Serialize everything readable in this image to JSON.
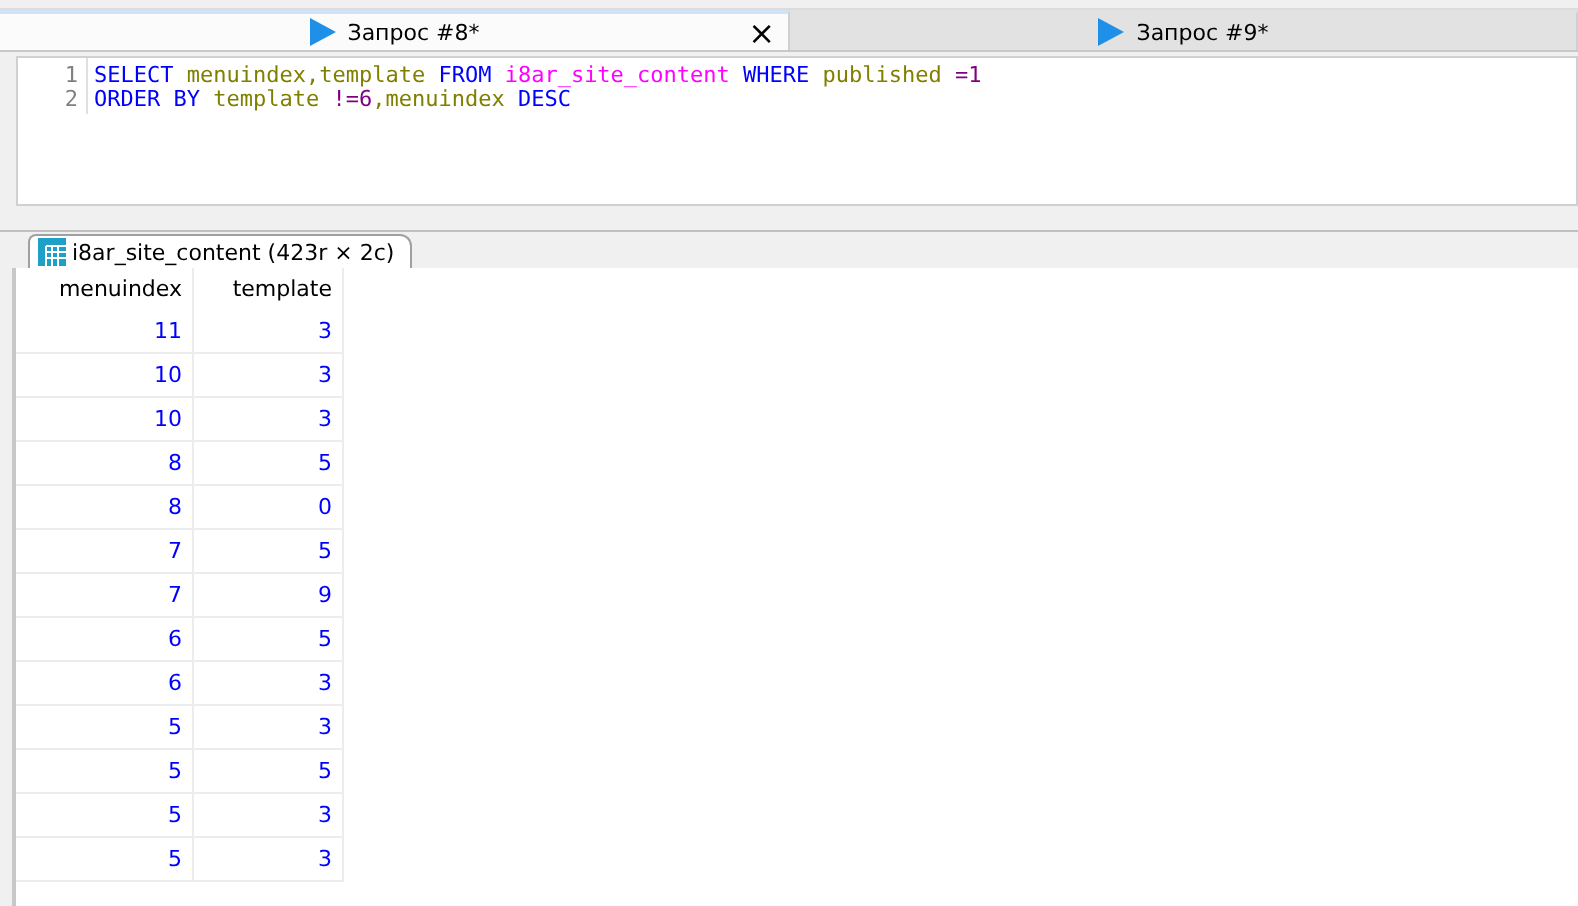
{
  "tabs": [
    {
      "label": "Запрос #8*",
      "selected": true,
      "close": "×"
    },
    {
      "label": "Запрос #9*",
      "selected": false
    }
  ],
  "editor": {
    "lines": [
      {
        "number": "1",
        "tokens": [
          {
            "kind": "keyword",
            "text": "SELECT "
          },
          {
            "kind": "ident",
            "text": "menuindex,template "
          },
          {
            "kind": "keyword",
            "text": "FROM "
          },
          {
            "kind": "table",
            "text": "i8ar_site_content "
          },
          {
            "kind": "keyword",
            "text": "WHERE "
          },
          {
            "kind": "ident",
            "text": "published "
          },
          {
            "kind": "op",
            "text": "=1"
          }
        ]
      },
      {
        "number": "2",
        "tokens": [
          {
            "kind": "keyword",
            "text": "ORDER BY "
          },
          {
            "kind": "ident",
            "text": "template "
          },
          {
            "kind": "op",
            "text": "!=6"
          },
          {
            "kind": "ident",
            "text": ",menuindex "
          },
          {
            "kind": "keyword",
            "text": "DESC"
          }
        ]
      }
    ]
  },
  "result_tab": {
    "label": "i8ar_site_content (423r × 2c)",
    "selected": true
  },
  "table": {
    "columns": [
      "menuindex",
      "template"
    ],
    "rows": [
      [
        "11",
        "3"
      ],
      [
        "10",
        "3"
      ],
      [
        "10",
        "3"
      ],
      [
        "8",
        "5"
      ],
      [
        "8",
        "0"
      ],
      [
        "7",
        "5"
      ],
      [
        "7",
        "9"
      ],
      [
        "6",
        "5"
      ],
      [
        "6",
        "3"
      ],
      [
        "5",
        "3"
      ],
      [
        "5",
        "5"
      ],
      [
        "5",
        "3"
      ],
      [
        "5",
        "3"
      ]
    ]
  }
}
